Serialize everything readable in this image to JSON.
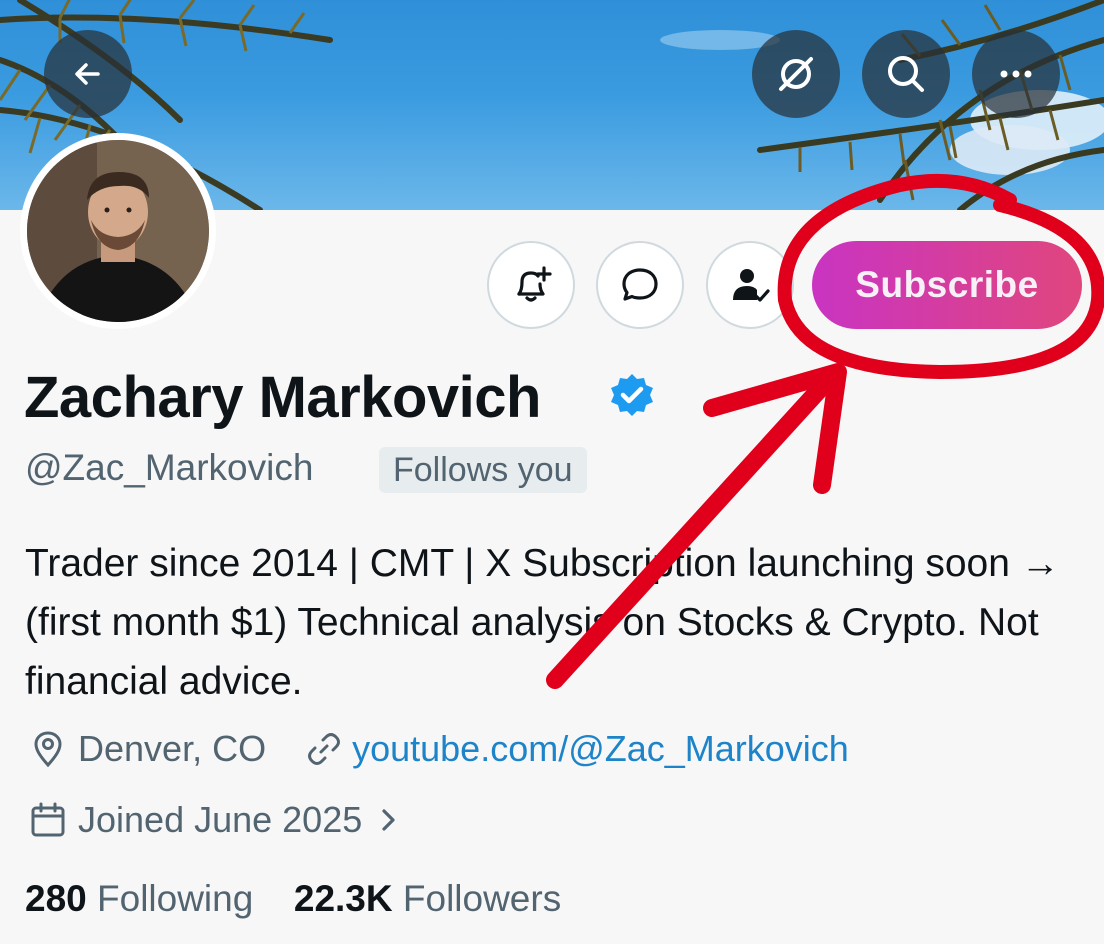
{
  "header": {
    "back_icon": "arrow-left-icon",
    "grok_icon": "grok-icon",
    "search_icon": "search-icon",
    "more_icon": "more-horizontal-icon"
  },
  "profile": {
    "name": "Zachary Markovich",
    "handle": "@Zac_Markovich",
    "follows_you": "Follows you",
    "bio": "Trader since 2014 | CMT | X Subscription launching soon → (first month $1) Technical analysis on Stocks & Crypto. Not financial advice.",
    "location": "Denver, CO",
    "website": "youtube.com/@Zac_Markovich",
    "joined": "Joined June 2025",
    "following_count": "280",
    "following_label": "Following",
    "followers_count": "22.3K",
    "followers_label": "Followers"
  },
  "actions": {
    "subscribe_label": "Subscribe",
    "notify_icon": "bell-plus-icon",
    "message_icon": "message-bubble-icon",
    "following_icon": "person-check-icon"
  },
  "colors": {
    "subscribe_gradient_start": "#c934c2",
    "subscribe_gradient_end": "#e0467d",
    "verified_badge": "#1d9bf0",
    "link": "#1d84c9",
    "annotation_red": "#e0001b"
  }
}
